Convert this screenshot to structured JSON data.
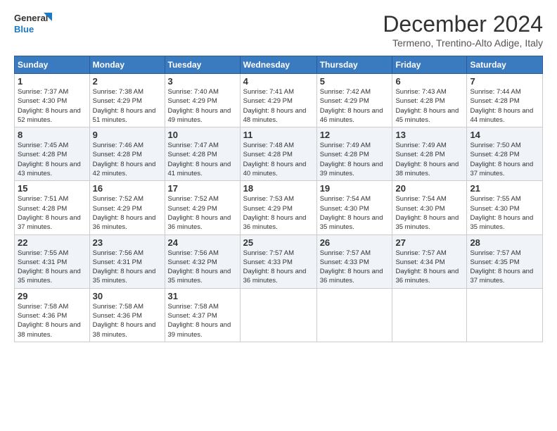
{
  "logo": {
    "line1": "General",
    "line2": "Blue"
  },
  "title": "December 2024",
  "location": "Termeno, Trentino-Alto Adige, Italy",
  "weekdays": [
    "Sunday",
    "Monday",
    "Tuesday",
    "Wednesday",
    "Thursday",
    "Friday",
    "Saturday"
  ],
  "weeks": [
    [
      {
        "day": "1",
        "sunrise": "7:37 AM",
        "sunset": "4:30 PM",
        "daylight": "8 hours and 52 minutes."
      },
      {
        "day": "2",
        "sunrise": "7:38 AM",
        "sunset": "4:29 PM",
        "daylight": "8 hours and 51 minutes."
      },
      {
        "day": "3",
        "sunrise": "7:40 AM",
        "sunset": "4:29 PM",
        "daylight": "8 hours and 49 minutes."
      },
      {
        "day": "4",
        "sunrise": "7:41 AM",
        "sunset": "4:29 PM",
        "daylight": "8 hours and 48 minutes."
      },
      {
        "day": "5",
        "sunrise": "7:42 AM",
        "sunset": "4:29 PM",
        "daylight": "8 hours and 46 minutes."
      },
      {
        "day": "6",
        "sunrise": "7:43 AM",
        "sunset": "4:28 PM",
        "daylight": "8 hours and 45 minutes."
      },
      {
        "day": "7",
        "sunrise": "7:44 AM",
        "sunset": "4:28 PM",
        "daylight": "8 hours and 44 minutes."
      }
    ],
    [
      {
        "day": "8",
        "sunrise": "7:45 AM",
        "sunset": "4:28 PM",
        "daylight": "8 hours and 43 minutes."
      },
      {
        "day": "9",
        "sunrise": "7:46 AM",
        "sunset": "4:28 PM",
        "daylight": "8 hours and 42 minutes."
      },
      {
        "day": "10",
        "sunrise": "7:47 AM",
        "sunset": "4:28 PM",
        "daylight": "8 hours and 41 minutes."
      },
      {
        "day": "11",
        "sunrise": "7:48 AM",
        "sunset": "4:28 PM",
        "daylight": "8 hours and 40 minutes."
      },
      {
        "day": "12",
        "sunrise": "7:49 AM",
        "sunset": "4:28 PM",
        "daylight": "8 hours and 39 minutes."
      },
      {
        "day": "13",
        "sunrise": "7:49 AM",
        "sunset": "4:28 PM",
        "daylight": "8 hours and 38 minutes."
      },
      {
        "day": "14",
        "sunrise": "7:50 AM",
        "sunset": "4:28 PM",
        "daylight": "8 hours and 37 minutes."
      }
    ],
    [
      {
        "day": "15",
        "sunrise": "7:51 AM",
        "sunset": "4:28 PM",
        "daylight": "8 hours and 37 minutes."
      },
      {
        "day": "16",
        "sunrise": "7:52 AM",
        "sunset": "4:29 PM",
        "daylight": "8 hours and 36 minutes."
      },
      {
        "day": "17",
        "sunrise": "7:52 AM",
        "sunset": "4:29 PM",
        "daylight": "8 hours and 36 minutes."
      },
      {
        "day": "18",
        "sunrise": "7:53 AM",
        "sunset": "4:29 PM",
        "daylight": "8 hours and 36 minutes."
      },
      {
        "day": "19",
        "sunrise": "7:54 AM",
        "sunset": "4:30 PM",
        "daylight": "8 hours and 35 minutes."
      },
      {
        "day": "20",
        "sunrise": "7:54 AM",
        "sunset": "4:30 PM",
        "daylight": "8 hours and 35 minutes."
      },
      {
        "day": "21",
        "sunrise": "7:55 AM",
        "sunset": "4:30 PM",
        "daylight": "8 hours and 35 minutes."
      }
    ],
    [
      {
        "day": "22",
        "sunrise": "7:55 AM",
        "sunset": "4:31 PM",
        "daylight": "8 hours and 35 minutes."
      },
      {
        "day": "23",
        "sunrise": "7:56 AM",
        "sunset": "4:31 PM",
        "daylight": "8 hours and 35 minutes."
      },
      {
        "day": "24",
        "sunrise": "7:56 AM",
        "sunset": "4:32 PM",
        "daylight": "8 hours and 35 minutes."
      },
      {
        "day": "25",
        "sunrise": "7:57 AM",
        "sunset": "4:33 PM",
        "daylight": "8 hours and 36 minutes."
      },
      {
        "day": "26",
        "sunrise": "7:57 AM",
        "sunset": "4:33 PM",
        "daylight": "8 hours and 36 minutes."
      },
      {
        "day": "27",
        "sunrise": "7:57 AM",
        "sunset": "4:34 PM",
        "daylight": "8 hours and 36 minutes."
      },
      {
        "day": "28",
        "sunrise": "7:57 AM",
        "sunset": "4:35 PM",
        "daylight": "8 hours and 37 minutes."
      }
    ],
    [
      {
        "day": "29",
        "sunrise": "7:58 AM",
        "sunset": "4:36 PM",
        "daylight": "8 hours and 38 minutes."
      },
      {
        "day": "30",
        "sunrise": "7:58 AM",
        "sunset": "4:36 PM",
        "daylight": "8 hours and 38 minutes."
      },
      {
        "day": "31",
        "sunrise": "7:58 AM",
        "sunset": "4:37 PM",
        "daylight": "8 hours and 39 minutes."
      },
      null,
      null,
      null,
      null
    ]
  ]
}
